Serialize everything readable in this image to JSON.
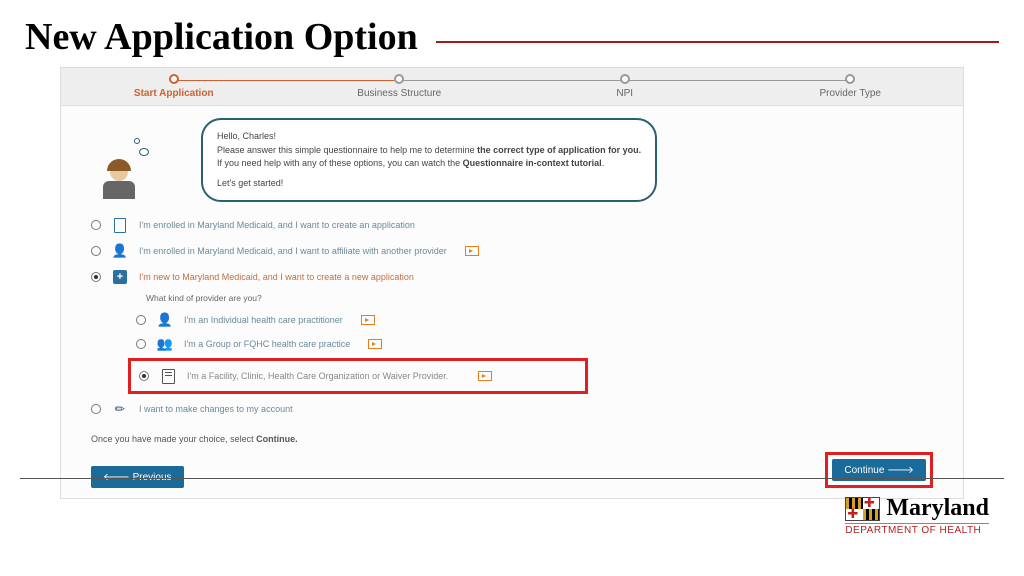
{
  "title": "New Application Option",
  "progress": {
    "steps": [
      "Start Application",
      "Business Structure",
      "NPI",
      "Provider Type"
    ]
  },
  "speech": {
    "greeting": "Hello, Charles!",
    "line1_a": "Please answer this simple questionnaire to help me to determine ",
    "line1_b": "the correct type of application for you.",
    "line2_a": "If you need help with any of these options, you can watch the ",
    "line2_b": "Questionnaire in-context tutorial",
    "line2_c": ".",
    "line3": "Let's get started!"
  },
  "options": {
    "o1": "I'm enrolled in Maryland Medicaid, and I want to create an application",
    "o2": "I'm enrolled in Maryland Medicaid, and I want to affiliate with another provider",
    "o3": "I'm new to Maryland Medicaid, and I want to create a new application",
    "sub_q": "What kind of provider are you?",
    "s1": "I'm an Individual health care practitioner",
    "s2": "I'm a Group or FQHC health care practice",
    "s3": "I'm a Facility, Clinic, Health Care Organization or Waiver Provider.",
    "o4": "I want to make changes to my account"
  },
  "footnote_a": "Once you have made your choice, select ",
  "footnote_b": "Continue.",
  "buttons": {
    "prev": "Previous",
    "cont": "Continue"
  },
  "logo": {
    "name": "Maryland",
    "dept": "DEPARTMENT OF HEALTH"
  }
}
